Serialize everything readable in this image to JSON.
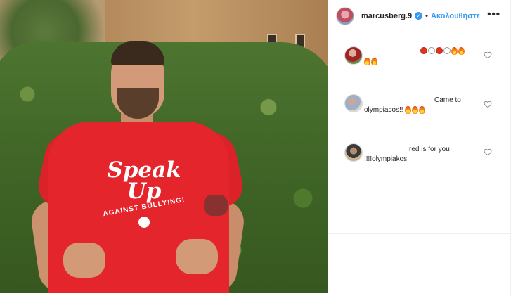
{
  "post": {
    "owner": {
      "username": "marcusberg.9",
      "verified": true,
      "separator": "•",
      "follow_label": "Ακολουθήστε",
      "more_label": "•••"
    },
    "photo": {
      "shirt_line1": "Speak",
      "shirt_line2": "Up",
      "shirt_line3": "AGAINST BULLYING!",
      "shirt_color": "#e4252c"
    },
    "comments": [
      {
        "line1_emojis": [
          "red-circle",
          "white-circle",
          "red-circle",
          "white-circle",
          "fire",
          "fire"
        ],
        "line2_emojis": [
          "fire",
          "fire"
        ],
        "text": "",
        "meta": "."
      },
      {
        "text_line1": "Came to",
        "text_line2": "olympiacos!!",
        "trailing_emojis": [
          "fire",
          "fire",
          "fire"
        ]
      },
      {
        "text_line1": "red is for you",
        "text_line2": "!!!!olympiakos"
      }
    ]
  },
  "colors": {
    "accent": "#3897f0",
    "text": "#262626",
    "muted": "#8e8e8e",
    "border": "#efefef"
  },
  "icons": {
    "verified": "verified-badge-icon",
    "more": "more-options-icon",
    "heart": "heart-outline-icon"
  }
}
